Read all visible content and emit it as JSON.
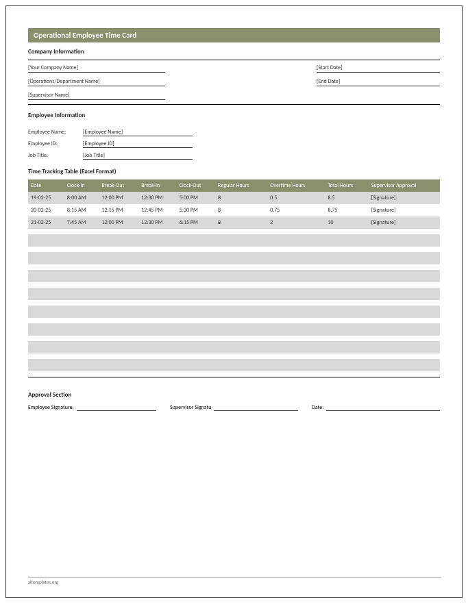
{
  "title": "Operational Employee Time Card",
  "company": {
    "heading": "Company Information",
    "name": "[Your Company Name]",
    "dept": "[Operations/Department Name]",
    "supervisor": "[Supervisor Name]",
    "start_date": "[Start Date]",
    "end_date": "[End Date]"
  },
  "employee": {
    "heading": "Employee Information",
    "name_label": "Employee Name:",
    "name_val": "[Employee Name]",
    "id_label": "Employee ID:",
    "id_val": "[Employee ID]",
    "title_label": "Job Title:",
    "title_val": "[Job Title]"
  },
  "table": {
    "heading": "Time Tracking Table (Excel Format)",
    "headers": {
      "date": "Date",
      "clock_in": "Clock-In",
      "break_out": "Break-Out",
      "break_in": "Break-In",
      "clock_out": "Clock-Out",
      "regular": "Regular Hours",
      "overtime": "Overtime Hours",
      "total": "Total Hours",
      "approval": "Supervisor Approval"
    },
    "rows": [
      {
        "date": "19-02-25",
        "clock_in": "8:00 AM",
        "break_out": "12:00 PM",
        "break_in": "12:30 PM",
        "clock_out": "5:00 PM",
        "regular": "8",
        "overtime": "0.5",
        "total": "8.5",
        "approval": "[Signature]"
      },
      {
        "date": "20-02-25",
        "clock_in": "8:15 AM",
        "break_out": "12:15 PM",
        "break_in": "12:45 PM",
        "clock_out": "5:30 PM",
        "regular": "8",
        "overtime": "0.75",
        "total": "8.75",
        "approval": "[Signature]"
      },
      {
        "date": "21-02-25",
        "clock_in": "7:45 AM",
        "break_out": "12:00 PM",
        "break_in": "12:30 PM",
        "clock_out": "6:15 PM",
        "regular": "8",
        "overtime": "2",
        "total": "10",
        "approval": "[Signature]"
      }
    ]
  },
  "approval": {
    "heading": "Approval Section",
    "emp_sig": "Employee Signature:",
    "sup_sig": "Supervisor Signatu",
    "date": "Date:"
  },
  "footer": "xltemplates.org"
}
